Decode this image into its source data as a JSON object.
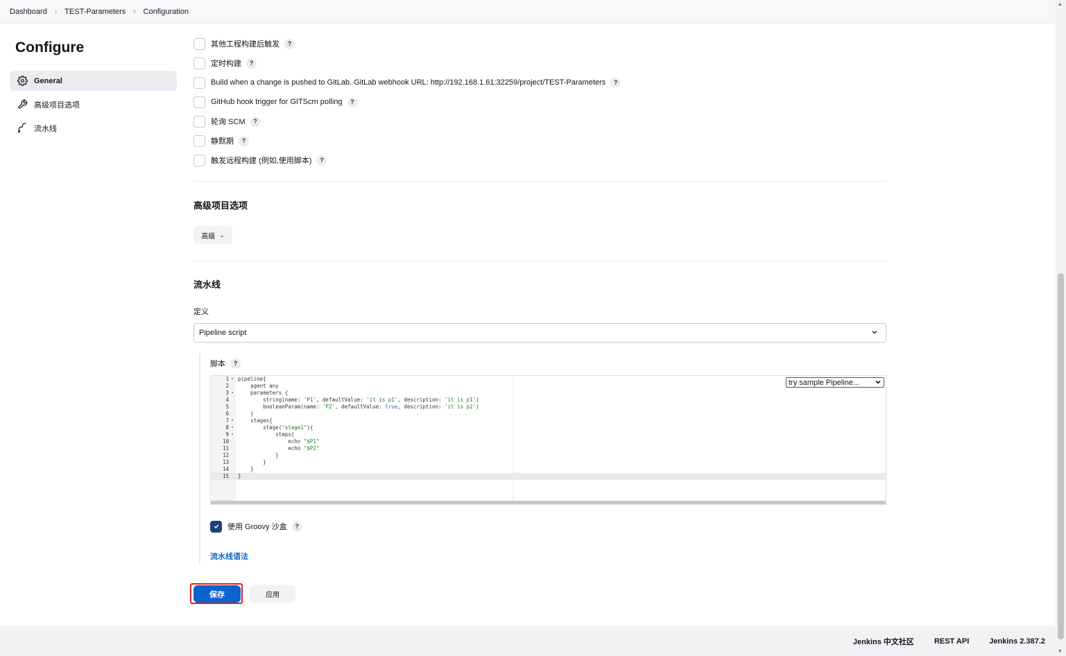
{
  "breadcrumb": {
    "items": [
      "Dashboard",
      "TEST-Parameters",
      "Configuration"
    ]
  },
  "sidebar": {
    "title": "Configure",
    "items": [
      {
        "label": "General",
        "icon": "gear-icon",
        "active": true
      },
      {
        "label": "高级项目选项",
        "icon": "wrench-icon",
        "active": false
      },
      {
        "label": "流水线",
        "icon": "pipeline-icon",
        "active": false
      }
    ]
  },
  "triggers": [
    {
      "label": "其他工程构建后触发",
      "checked": false
    },
    {
      "label": "定时构建",
      "checked": false
    },
    {
      "label": "Build when a change is pushed to GitLab. GitLab webhook URL: http://192.168.1.61:32259/project/TEST-Parameters",
      "checked": false
    },
    {
      "label": "GitHub hook trigger for GITScm polling",
      "checked": false
    },
    {
      "label": "轮询 SCM",
      "checked": false
    },
    {
      "label": "静默期",
      "checked": false
    },
    {
      "label": "触发远程构建 (例如,使用脚本)",
      "checked": false
    }
  ],
  "help_symbol": "?",
  "advanced": {
    "title": "高级项目选项",
    "button_label": "高级"
  },
  "pipeline": {
    "title": "流水线",
    "definition_label": "定义",
    "definition_value": "Pipeline script",
    "script_label": "脚本",
    "sample_label": "try sample Pipeline...",
    "code": [
      "pipeline{",
      "    agent any",
      "    parameters {",
      "        string(name: 'P1', defaultValue: 'it is p1', description: 'it is p1')",
      "        booleanParam(name: 'P2', defaultValue: true, description: 'it is p2')",
      "    }",
      "    stages{",
      "        stage(\"stage1\"){",
      "            steps{",
      "                echo \"$P1\"",
      "                echo \"$P2\"",
      "            }",
      "        }",
      "    }",
      "}"
    ],
    "fold_lines": [
      1,
      3,
      7,
      8,
      9
    ],
    "active_line": 15,
    "groovy_label": "使用 Groovy 沙盒",
    "groovy_checked": true,
    "syntax_link": "流水线语法"
  },
  "actions": {
    "save": "保存",
    "apply": "应用"
  },
  "footer": {
    "links": [
      "Jenkins 中文社区",
      "REST API",
      "Jenkins 2.387.2"
    ]
  },
  "colors": {
    "primary": "#0b63cf",
    "highlight_border": "#e01f1f",
    "link": "#1565c0",
    "checked": "#1d3f7a"
  }
}
